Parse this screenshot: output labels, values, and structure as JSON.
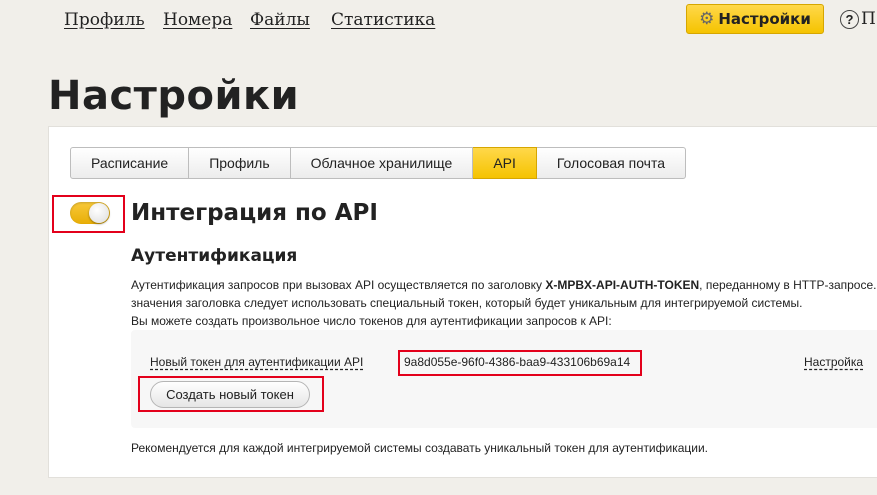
{
  "topnav": {
    "links": [
      "Профиль",
      "Номера",
      "Файлы",
      "Статистика"
    ],
    "settings_label": "Настройки",
    "help_label": "П"
  },
  "page": {
    "title": "Настройки"
  },
  "tabs": [
    {
      "label": "Расписание",
      "active": false
    },
    {
      "label": "Профиль",
      "active": false
    },
    {
      "label": "Облачное хранилище",
      "active": false
    },
    {
      "label": "API",
      "active": true
    },
    {
      "label": "Голосовая почта",
      "active": false
    }
  ],
  "api": {
    "toggle_on": true,
    "title": "Интеграция по API",
    "auth_title": "Аутентификация",
    "desc_line1_pre": "Аутентификация запросов при вызовах API осуществляется по заголовку ",
    "desc_line1_bold": "X-MPBX-API-AUTH-TOKEN",
    "desc_line1_post": ", переданному в HTTP-запросе. В",
    "desc_line2": "значения заголовка следует использовать специальный токен, который будет уникальным для интегрируемой системы.",
    "desc_line3": "Вы можете создать произвольное число токенов для аутентификации запросов к API:",
    "token_label": "Новый токен для аутентификации API",
    "token_value": "9a8d055e-96f0-4386-baa9-433106b69a14",
    "setup_link": "Настройка",
    "create_button": "Создать новый токен",
    "footer_note": "Рекомендуется для каждой интегрируемой системы создавать уникальный токен для аутентификации."
  },
  "colors": {
    "accent": "#f5c300",
    "highlight": "#e3001b"
  }
}
